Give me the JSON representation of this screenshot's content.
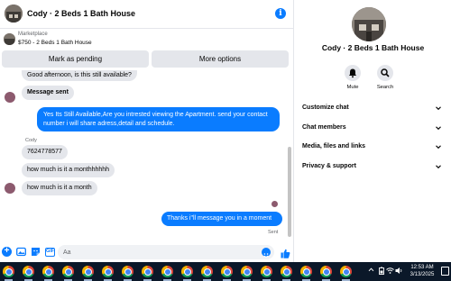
{
  "chat": {
    "header_title": "Cody · 2 Beds 1 Bath House",
    "listing": {
      "label": "Marketplace",
      "title": "$750 - 2 Beds 1 Bath House"
    },
    "actions": {
      "mark_pending": "Mark as pending",
      "more_options": "More options"
    },
    "messages": {
      "m1": "Good afternoon, is this still available?",
      "m2": "Message sent",
      "m3": "Yes Its Still Available,Are you intrested viewing the Apartment. send your contact number i will share adress,detail and schedule.",
      "sender": "Cody",
      "m4": "7624778577",
      "m5": "how much is it a monthhhhhh",
      "m6": "how much is it a month",
      "m7": "Thanks i\"ll message you in a moment",
      "status": "Sent"
    },
    "composer": {
      "placeholder": "Aa",
      "gif_label": "GIF"
    }
  },
  "side": {
    "title": "Cody · 2 Beds 1 Bath House",
    "mute_label": "Mute",
    "search_label": "Search",
    "sections": {
      "s1": "Customize chat",
      "s2": "Chat members",
      "s3": "Media, files and links",
      "s4": "Privacy & support"
    }
  },
  "taskbar": {
    "time": "12:53 AM",
    "date": "3/13/2025",
    "app_icons": "chrome-icon"
  },
  "colors": {
    "accent": "#0a7cff",
    "bubble_in": "#e4e6eb",
    "taskbar": "#0b1829"
  }
}
